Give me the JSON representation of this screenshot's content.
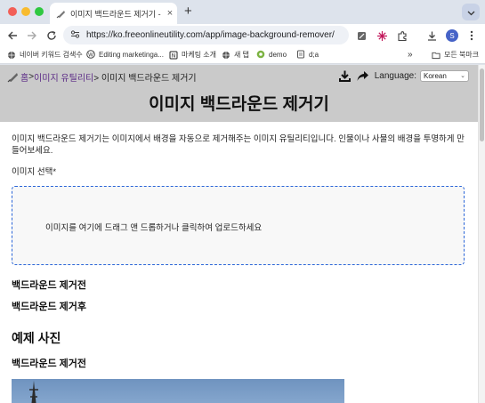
{
  "browser": {
    "tab_title": "이미지 백드라운드 제거기 - 이미지 ...",
    "tab_close": "×",
    "new_tab": "+",
    "url": "https://ko.freeonlineutility.com/app/image-background-remover/",
    "profile_initial": "S"
  },
  "bookmarks": {
    "items": [
      {
        "label": "네이버 키워드 검색수",
        "icon": "naver-icon"
      },
      {
        "label": "Editing marketinga...",
        "icon": "wordpress-icon"
      },
      {
        "label": "마케팅 소개",
        "icon": "notion-icon"
      },
      {
        "label": "새 탭",
        "icon": "globe-icon"
      },
      {
        "label": "demo",
        "icon": "demo-icon"
      },
      {
        "label": "d;a",
        "icon": "page-icon"
      }
    ],
    "more": "»",
    "all_bookmarks": "모든 북마크"
  },
  "page": {
    "breadcrumb_home": "홈",
    "breadcrumb_sep1": ">",
    "breadcrumb_utils": "이미지 유틸리티",
    "breadcrumb_current": "> 이미지 백드라운드 제거기",
    "language_label": "Language:",
    "language_value": "Korean",
    "title": "이미지 백드라운드 제거기",
    "description": "이미지 백드라운드 제거기는 이미지에서 배경을 자동으로 제거해주는 이미지 유틸리티입니다. 인물이나 사물의 배경을 투명하게 만들어보세요.",
    "select_label": "이미지 선택*",
    "dropzone_text": "이미지를 여기에 드래그 앤 드롭하거나 클릭하여 업로드하세요",
    "before_heading": "백드라운드 제거전",
    "after_heading": "백드라운드 제거후",
    "example_heading": "예제 사진",
    "example_before_heading": "백드라운드 제거전"
  },
  "colors": {
    "header_bg": "#cacaca",
    "link": "#5b2a86",
    "dropzone_border": "#2a65d8"
  }
}
